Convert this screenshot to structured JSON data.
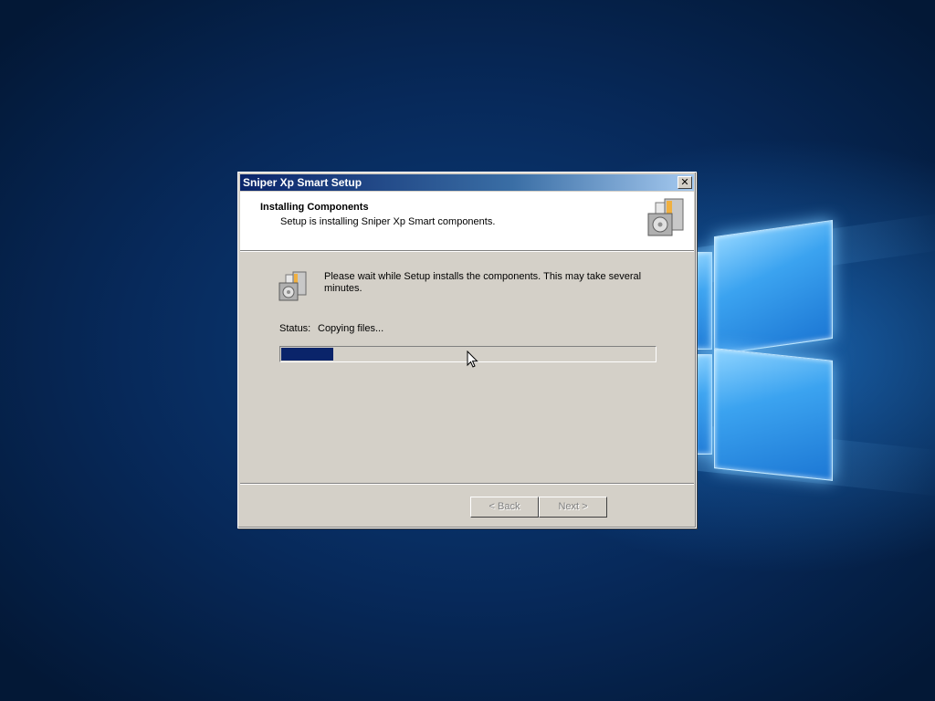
{
  "window": {
    "title": "Sniper Xp Smart Setup",
    "close_glyph": "✕"
  },
  "header": {
    "title": "Installing Components",
    "subtitle": "Setup is installing Sniper Xp Smart components.",
    "icon": "installer-box-icon"
  },
  "body": {
    "icon": "installer-box-icon",
    "message": "Please wait while Setup installs the components.  This may take several minutes.",
    "status_label": "Status:",
    "status_value": "Copying files...",
    "progress_percent": 14
  },
  "buttons": {
    "back_label": "< Back",
    "next_label": "Next >"
  },
  "colors": {
    "progress_fill": "#0a246a",
    "dialog_face": "#d4d0c8",
    "titlebar_start": "#0a246a",
    "titlebar_end": "#a6caf0"
  }
}
